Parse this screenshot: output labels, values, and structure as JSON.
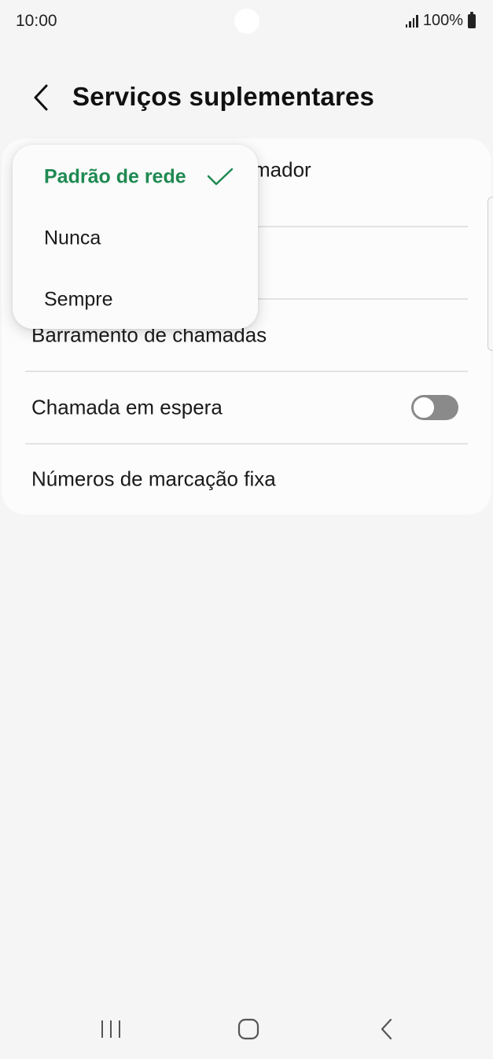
{
  "status_bar": {
    "time": "10:00",
    "battery": "100%",
    "icons": [
      "signal-icon",
      "battery-icon"
    ]
  },
  "header": {
    "title": "Serviços suplementares",
    "back_icon": "back-arrow-icon"
  },
  "settings": {
    "caller_id_label_partial": "mador",
    "call_barring_label": "Barramento de chamadas",
    "call_waiting_label": "Chamada em espera",
    "call_waiting_enabled": false,
    "fixed_dialing_label": "Números de marcação fixa"
  },
  "dropdown": {
    "options": [
      {
        "label": "Padrão de rede",
        "selected": true
      },
      {
        "label": "Nunca",
        "selected": false
      },
      {
        "label": "Sempre",
        "selected": false
      }
    ],
    "selected_color": "#1f8a52"
  },
  "nav_bar": {
    "icons": [
      "recents-icon",
      "home-icon",
      "back-icon"
    ]
  }
}
